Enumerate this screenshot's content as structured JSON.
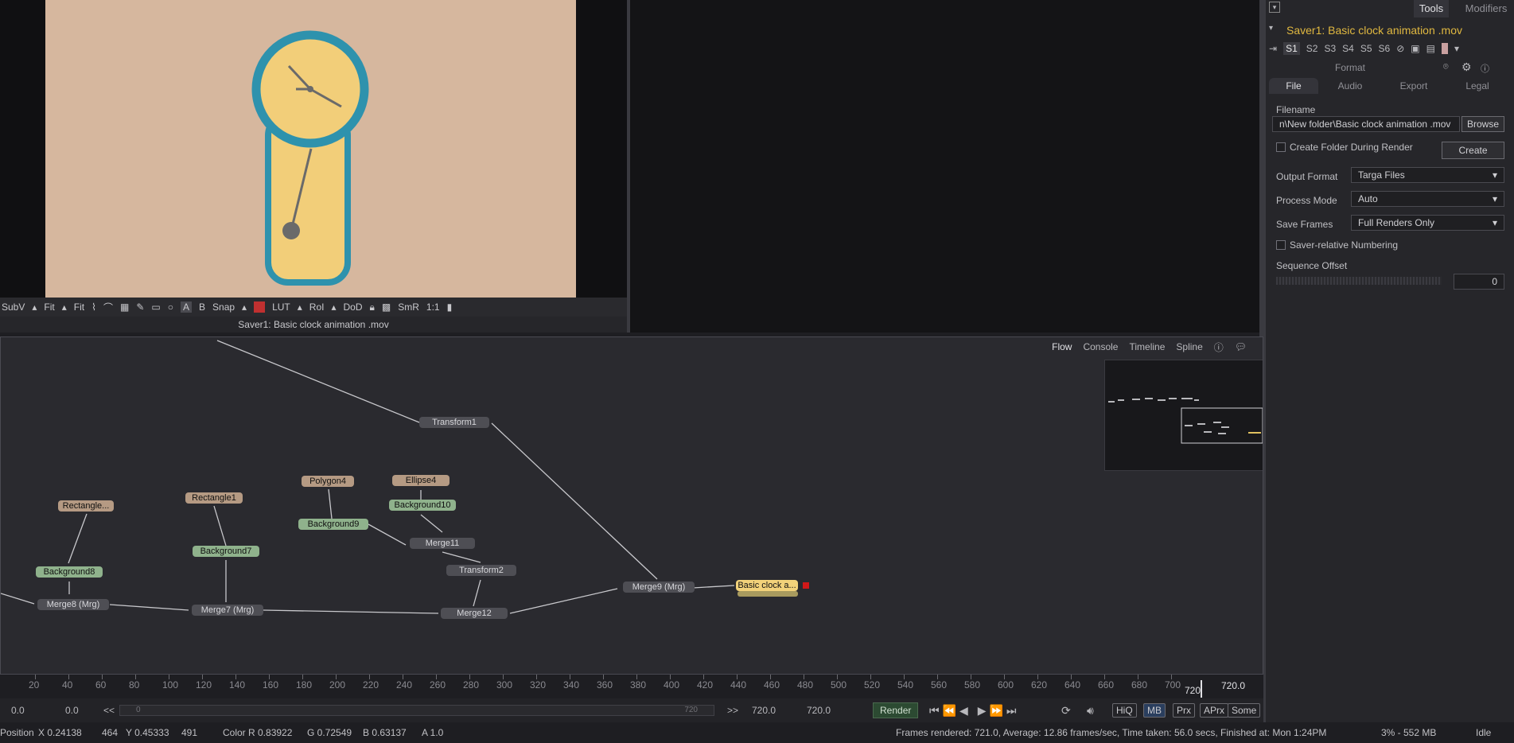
{
  "viewer_left": {
    "toolbar": [
      "SubV",
      "Fit",
      "Fit",
      "Snap",
      "LUT",
      "RoI",
      "DoD",
      "SmR",
      "1:1"
    ],
    "text_tools": [
      "A",
      "B"
    ],
    "caption": "Saver1: Basic clock animation .mov"
  },
  "panel": {
    "tabs": [
      "Tools",
      "Modifiers"
    ],
    "tool_title": "Saver1: Basic clock animation .mov",
    "slots": [
      "S1",
      "S2",
      "S3",
      "S4",
      "S5",
      "S6"
    ],
    "section": "Format",
    "subtabs": [
      "File",
      "Audio",
      "Export",
      "Legal"
    ],
    "filename_label": "Filename",
    "filename_value": "n\\New folder\\Basic clock animation .mov",
    "browse": "Browse",
    "create_folder": "Create Folder During Render",
    "create": "Create",
    "output_format_label": "Output Format",
    "output_format_value": "Targa Files",
    "process_mode_label": "Process Mode",
    "process_mode_value": "Auto",
    "save_frames_label": "Save Frames",
    "save_frames_value": "Full Renders Only",
    "saver_relative": "Saver-relative Numbering",
    "sequence_offset_label": "Sequence Offset",
    "sequence_offset_value": "0"
  },
  "flow": {
    "tabs": [
      "Flow",
      "Console",
      "Timeline",
      "Spline"
    ],
    "nodes": {
      "transform1": "Transform1",
      "rectangle": "Rectangle...",
      "rectangle1": "Rectangle1",
      "polygon4": "Polygon4",
      "ellipse4": "Ellipse4",
      "background10": "Background10",
      "background9": "Background9",
      "merge11": "Merge11",
      "background7": "Background7",
      "background8": "Background8",
      "transform2": "Transform2",
      "merge9": "Merge9  (Mrg)",
      "saver": "Basic clock a...",
      "merge8": "Merge8  (Mrg)",
      "merge7": "Merge7  (Mrg)",
      "merge12": "Merge12"
    }
  },
  "ruler": {
    "ticks": [
      "20",
      "40",
      "60",
      "80",
      "100",
      "120",
      "140",
      "160",
      "180",
      "200",
      "220",
      "240",
      "260",
      "280",
      "300",
      "320",
      "340",
      "360",
      "380",
      "400",
      "420",
      "440",
      "460",
      "480",
      "500",
      "520",
      "540",
      "560",
      "580",
      "600",
      "620",
      "640",
      "660",
      "680",
      "700"
    ],
    "current": "720",
    "end_value": "720.0"
  },
  "transport": {
    "start": "0.0",
    "range_start": "0.0",
    "back": "<<",
    "slider_start": "0",
    "slider_end": "720",
    "fwd": ">>",
    "end1": "720.0",
    "end2": "720.0",
    "render": "Render",
    "flags": [
      "HiQ",
      "MB",
      "Prx",
      "APrx",
      "Some"
    ]
  },
  "status": {
    "position_label": "Position",
    "x": "X  0.24138",
    "x_px": "464",
    "y": "Y  0.45333",
    "y_px": "491",
    "color_r": "Color R  0.83922",
    "g": "G  0.72549",
    "b": "B  0.63137",
    "a": "A  1.0",
    "frames": "Frames rendered: 721.0,  Average: 12.86 frames/sec,  Time taken: 56.0 secs,  Finished at: Mon 1:24PM",
    "memory": "3% - 552 MB",
    "state": "Idle"
  }
}
